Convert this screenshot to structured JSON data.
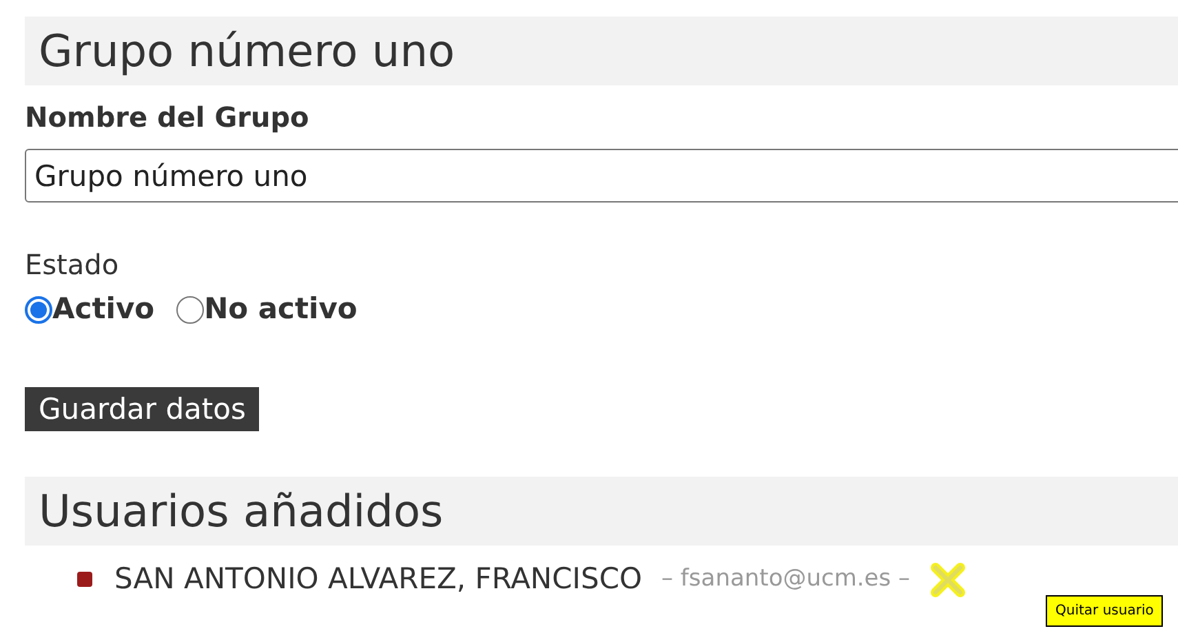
{
  "group_title": "Grupo número uno",
  "name_field": {
    "label": "Nombre del Grupo",
    "value": "Grupo número uno"
  },
  "status": {
    "label": "Estado",
    "options": [
      {
        "label": "Activo",
        "selected": true
      },
      {
        "label": "No activo",
        "selected": false
      }
    ]
  },
  "save_button": "Guardar datos",
  "users_title": "Usuarios añadidos",
  "users": [
    {
      "name": "SAN ANTONIO ALVAREZ, FRANCISCO",
      "email": "– fsananto@ucm.es –",
      "remove_hovered": true,
      "tooltip": "Quitar usuario"
    }
  ]
}
